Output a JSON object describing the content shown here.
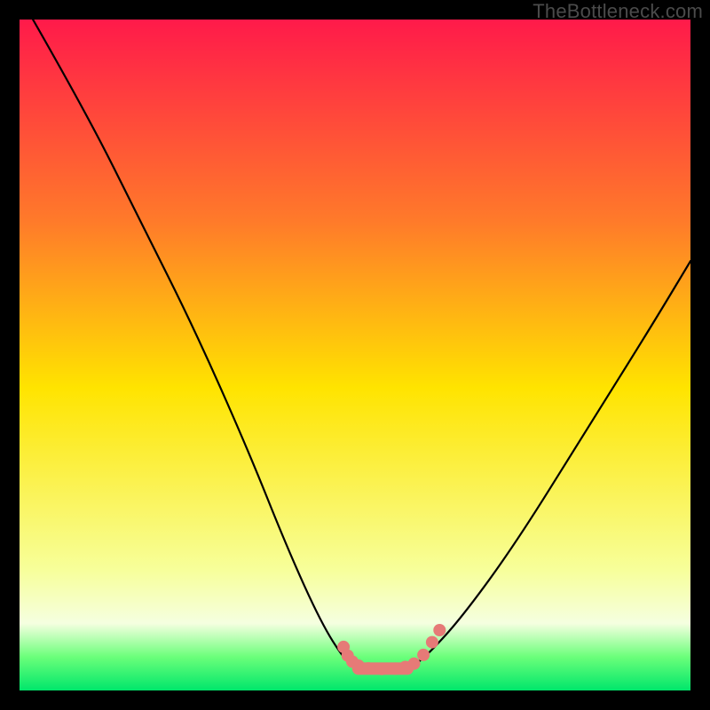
{
  "watermark": "TheBottleneck.com",
  "colors": {
    "frame": "#000000",
    "gradient_top": "#ff1a4a",
    "gradient_upper": "#ff7a2a",
    "gradient_mid": "#ffe400",
    "gradient_lower": "#f7ff9a",
    "gradient_base_band": "#f5ffe0",
    "gradient_green_top": "#6bff7a",
    "gradient_green_bottom": "#00e66b",
    "curve": "#000000",
    "marker": "#e67a77"
  },
  "chart_data": {
    "type": "line",
    "title": "",
    "xlabel": "",
    "ylabel": "",
    "xlim": [
      0,
      100
    ],
    "ylim": [
      0,
      100
    ],
    "grid": false,
    "legend": false,
    "note": "Stylized bottleneck V-curve on a vertical rainbow gradient background. Axes are unlabeled; values are estimated from pixel geometry. y=100 top of plot, y=0 bottom.",
    "series": [
      {
        "name": "left-arm",
        "x": [
          2,
          10,
          18,
          26,
          34,
          40,
          45,
          48.5,
          50
        ],
        "y": [
          100,
          86,
          70,
          54,
          36,
          21,
          10,
          4.5,
          3.5
        ]
      },
      {
        "name": "valley-floor",
        "x": [
          50,
          51,
          53,
          55,
          57,
          58.5
        ],
        "y": [
          3.5,
          3.3,
          3.2,
          3.2,
          3.3,
          3.5
        ]
      },
      {
        "name": "right-arm",
        "x": [
          58.5,
          61,
          66,
          74,
          84,
          94,
          100
        ],
        "y": [
          3.5,
          5.5,
          11,
          22,
          38,
          54,
          64
        ]
      }
    ],
    "markers": {
      "name": "valley-beads",
      "shape": "rounded",
      "approx_radius_px": 7,
      "points": [
        {
          "x": 48.3,
          "y": 6.5
        },
        {
          "x": 48.9,
          "y": 5.2
        },
        {
          "x": 49.6,
          "y": 4.3
        },
        {
          "x": 50.5,
          "y": 3.7
        },
        {
          "x": 52.0,
          "y": 3.3
        },
        {
          "x": 54.0,
          "y": 3.2
        },
        {
          "x": 56.0,
          "y": 3.25
        },
        {
          "x": 57.5,
          "y": 3.5
        },
        {
          "x": 58.8,
          "y": 4.0
        },
        {
          "x": 60.2,
          "y": 5.3
        },
        {
          "x": 61.5,
          "y": 7.2
        },
        {
          "x": 62.6,
          "y": 9.0
        }
      ],
      "floor_pill": {
        "x0": 50.5,
        "x1": 57.8,
        "y": 3.25
      }
    }
  }
}
